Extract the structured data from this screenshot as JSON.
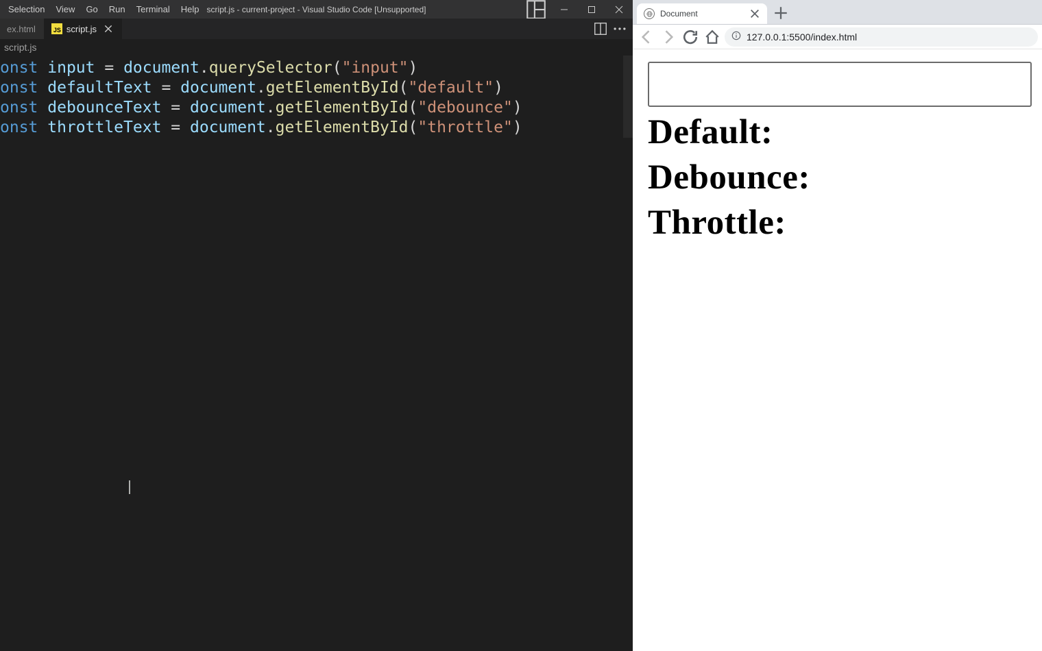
{
  "vscode": {
    "menus": [
      "Selection",
      "View",
      "Go",
      "Run",
      "Terminal",
      "Help"
    ],
    "title": "script.js - current-project - Visual Studio Code [Unsupported]",
    "tabs": [
      {
        "label": "ex.html",
        "active": false,
        "icon": "html"
      },
      {
        "label": "script.js",
        "active": true,
        "icon": "js"
      }
    ],
    "breadcrumb": "script.js",
    "code": [
      {
        "kw": "onst",
        "var": "input",
        "rhs_obj": "document",
        "rhs_fn": "querySelector",
        "rhs_arg": "\"input\""
      },
      {
        "kw": "onst",
        "var": "defaultText",
        "rhs_obj": "document",
        "rhs_fn": "getElementById",
        "rhs_arg": "\"default\""
      },
      {
        "kw": "onst",
        "var": "debounceText",
        "rhs_obj": "document",
        "rhs_fn": "getElementById",
        "rhs_arg": "\"debounce\""
      },
      {
        "kw": "onst",
        "var": "throttleText",
        "rhs_obj": "document",
        "rhs_fn": "getElementById",
        "rhs_arg": "\"throttle\""
      }
    ]
  },
  "browser": {
    "tab_title": "Document",
    "url": "127.0.0.1:5500/index.html",
    "page": {
      "input_value": "",
      "default_label": "Default:",
      "debounce_label": "Debounce:",
      "throttle_label": "Throttle:"
    }
  }
}
